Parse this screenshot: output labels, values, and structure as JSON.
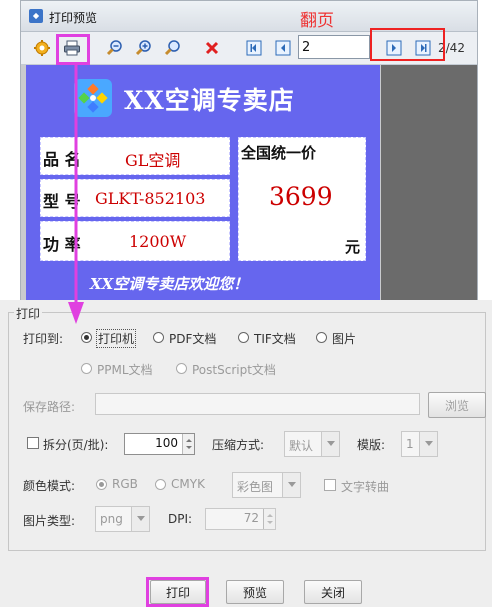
{
  "preview_window": {
    "title": "打印预览",
    "page_input_value": "2",
    "page_count": "2/42",
    "toolbar_icons": [
      "settings-gear-icon",
      "printer-icon",
      "zoom-out-icon",
      "zoom-in-icon",
      "zoom-fit-icon",
      "close-x-icon",
      "first-page-icon",
      "prev-page-icon",
      "next-page-icon",
      "last-page-icon"
    ]
  },
  "price_tag": {
    "shop_title": "XX空调专卖店",
    "name_label": "品 名",
    "name_value": "GL空调",
    "model_label": "型 号",
    "model_value": "GLKT-852103",
    "power_label": "功 率",
    "power_value": "1200W",
    "price_caption": "全国统一价",
    "price_value": "3699",
    "price_unit": "元",
    "welcome": "XX空调专卖店欢迎您！"
  },
  "annotations": {
    "paging_label": "翻页",
    "highlight_color": "#e040e0",
    "paging_color": "#ee2222"
  },
  "print_dialog": {
    "group_title": "打印",
    "print_to_label": "打印到:",
    "targets": [
      "打印机",
      "PDF文档",
      "TIF文档",
      "图片",
      "PPML文档",
      "PostScript文档"
    ],
    "selected_target": "打印机",
    "save_path_label": "保存路径:",
    "save_path_value": "",
    "browse_button": "浏览",
    "split_label": "拆分(页/批):",
    "split_value": "100",
    "compress_label": "压缩方式:",
    "compress_value": "默认",
    "template_label": "模版:",
    "template_value": "1",
    "color_mode_label": "颜色模式:",
    "color_modes": [
      "RGB",
      "CMYK"
    ],
    "color_mode_selected": "RGB",
    "color_combo_value": "彩色图",
    "text_to_curve_label": "文字转曲",
    "image_type_label": "图片类型:",
    "image_type_value": "png",
    "dpi_label": "DPI:",
    "dpi_value": "72",
    "print_button": "打印",
    "preview_button": "预览",
    "close_button": "关闭"
  }
}
